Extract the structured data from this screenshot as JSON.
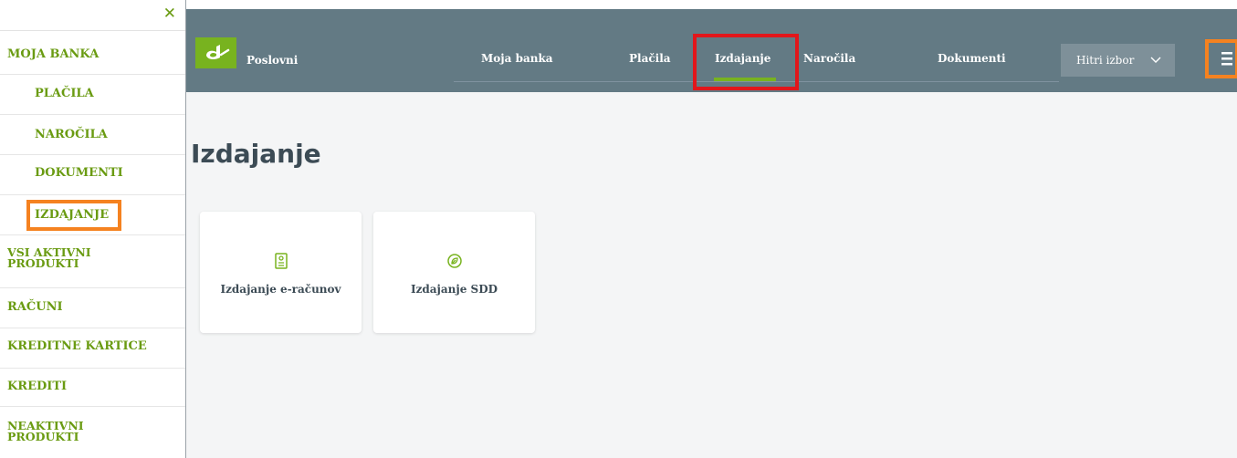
{
  "sidebar": {
    "close_icon": "close-icon",
    "items": [
      {
        "label": "MOJA BANKA"
      },
      {
        "label": "PLAČILA"
      },
      {
        "label": "NAROČILA"
      },
      {
        "label": "DOKUMENTI"
      },
      {
        "label": "IZDAJANJE"
      },
      {
        "label": "VSI AKTIVNI\nPRODUKTI"
      },
      {
        "label": "RAČUNI"
      },
      {
        "label": "KREDITNE KARTICE"
      },
      {
        "label": "KREDITI"
      },
      {
        "label": "NEAKTIVNI\nPRODUKTI"
      }
    ]
  },
  "header": {
    "brand": "Poslovni",
    "nav": [
      {
        "label": "Moja banka"
      },
      {
        "label": "Plačila"
      },
      {
        "label": "Izdajanje"
      },
      {
        "label": "Naročila"
      },
      {
        "label": "Dokumenti"
      }
    ],
    "quick_select": "Hitri izbor",
    "menu_icon": "hamburger-menu-icon"
  },
  "main": {
    "title": "Izdajanje",
    "cards": [
      {
        "label": "Izdajanje e-računov",
        "icon": "e-invoice-icon"
      },
      {
        "label": "Izdajanje SDD",
        "icon": "direct-debit-icon"
      }
    ]
  },
  "colors": {
    "accent_green": "#78b31f",
    "sidebar_text": "#6a9b12",
    "header_bg": "#637a84",
    "highlight_orange": "#f58220",
    "highlight_red": "#e2161b"
  }
}
